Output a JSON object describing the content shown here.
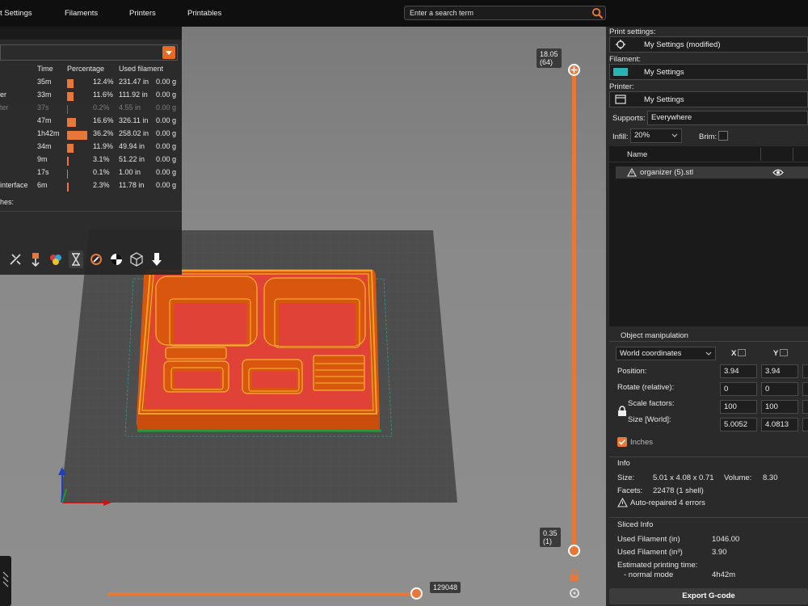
{
  "topbar": {
    "tabs": [
      "t Settings",
      "Filaments",
      "Printers",
      "Printables"
    ],
    "search_placeholder": "Enter a search term"
  },
  "stats": {
    "headers": {
      "time": "Time",
      "percentage": "Percentage",
      "used": "Used filament"
    },
    "rows": [
      {
        "name": "",
        "time": "35m",
        "pct": "12.4%",
        "pct_value": 12.4,
        "len": "231.47 in",
        "g": "0.00 g",
        "dim": false
      },
      {
        "name": "er",
        "time": "33m",
        "pct": "11.6%",
        "pct_value": 11.6,
        "len": "111.92 in",
        "g": "0.00 g",
        "dim": false
      },
      {
        "name": "ter",
        "time": "37s",
        "pct": "0.2%",
        "pct_value": 0.2,
        "len": "4.55 in",
        "g": "0.00 g",
        "dim": true
      },
      {
        "name": "",
        "time": "47m",
        "pct": "16.6%",
        "pct_value": 16.6,
        "len": "326.11 in",
        "g": "0.00 g",
        "dim": false
      },
      {
        "name": "",
        "time": "1h42m",
        "pct": "36.2%",
        "pct_value": 36.2,
        "len": "258.02 in",
        "g": "0.00 g",
        "dim": false
      },
      {
        "name": "",
        "time": "34m",
        "pct": "11.9%",
        "pct_value": 11.9,
        "len": "49.94 in",
        "g": "0.00 g",
        "dim": false
      },
      {
        "name": "",
        "time": "9m",
        "pct": "3.1%",
        "pct_value": 3.1,
        "len": "51.22 in",
        "g": "0.00 g",
        "dim": false
      },
      {
        "name": "",
        "time": "17s",
        "pct": "0.1%",
        "pct_value": 0.1,
        "len": "1.00 in",
        "g": "0.00 g",
        "dim": false
      },
      {
        "name": "interface",
        "time": "6m",
        "pct": "2.3%",
        "pct_value": 2.3,
        "len": "11.78 in",
        "g": "0.00 g",
        "dim": false
      }
    ],
    "footer": "hes:"
  },
  "slider": {
    "top_value": "18.05",
    "top_layer": "(64)",
    "bottom_value": "0.35",
    "bottom_layer": "(1)",
    "moves": "129048"
  },
  "right": {
    "print_settings_label": "Print settings:",
    "print_settings_value": "My Settings (modified)",
    "filament_label": "Filament:",
    "filament_value": "My Settings",
    "filament_color": "#29b2b2",
    "printer_label": "Printer:",
    "printer_value": "My Settings",
    "supports_label": "Supports:",
    "supports_value": "Everywhere",
    "infill_label": "Infill:",
    "infill_value": "20%",
    "brim_label": "Brim:",
    "list_header": "Name",
    "object_name": "organizer (5).stl",
    "manip_title": "Object manipulation",
    "coords": "World coordinates",
    "axis_x": "X",
    "axis_y": "Y",
    "position_label": "Position:",
    "rotate_label": "Rotate (relative):",
    "scale_label": "Scale factors:",
    "size_label": "Size [World]:",
    "pos_x": "3.94",
    "pos_y": "3.94",
    "rot_x": "0",
    "rot_y": "0",
    "scale_x": "100",
    "scale_y": "100",
    "size_x": "5.0052",
    "size_y": "4.0813",
    "inches_label": "Inches",
    "info_title": "Info",
    "size_key": "Size:",
    "size_val": "5.01 x 4.08 x 0.71",
    "volume_key": "Volume:",
    "volume_val": "8.30",
    "facets_key": "Facets:",
    "facets_val": "22478 (1 shell)",
    "repaired": "Auto-repaired 4 errors",
    "sliced_title": "Sliced Info",
    "used_in_key": "Used Filament (in)",
    "used_in_val": "1046.00",
    "used_in3_key": "Used Filament (in³)",
    "used_in3_val": "3.90",
    "est_key": "Estimated printing time:",
    "normal_key": "- normal mode",
    "normal_val": "4h42m",
    "export": "Export G-code"
  },
  "colors": {
    "accent": "#e8783a",
    "model": "#e05a16",
    "floor": "#e03a3a"
  }
}
